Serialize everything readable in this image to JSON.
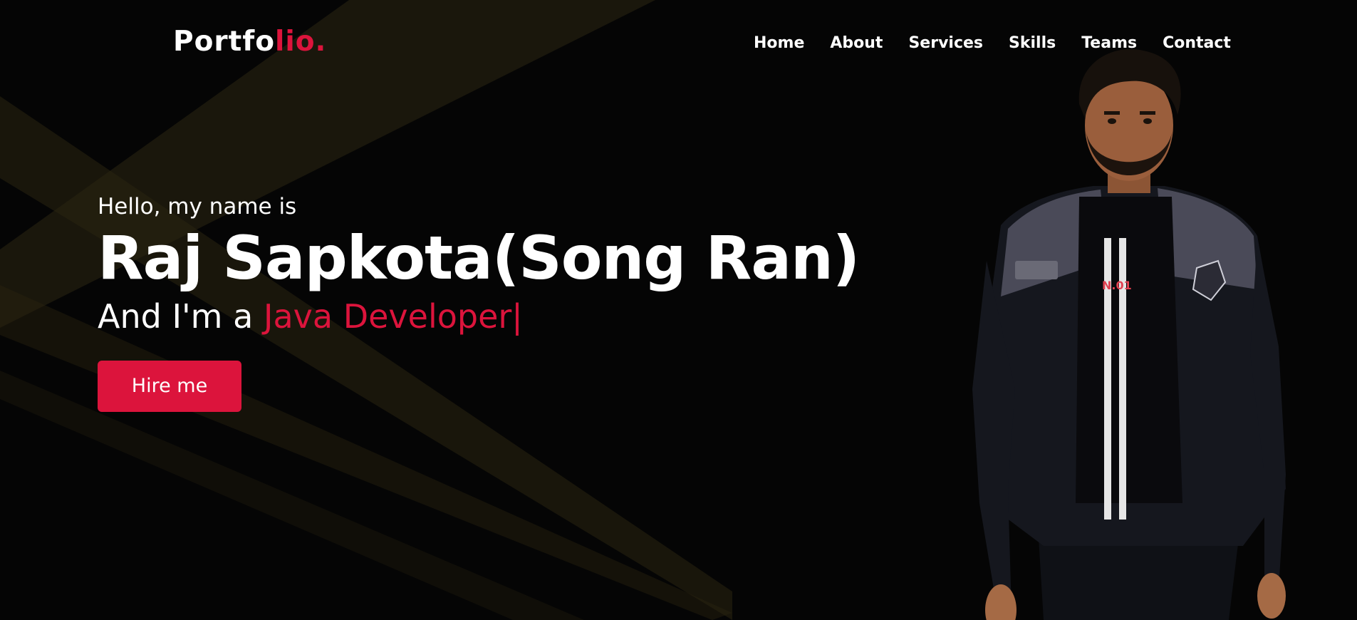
{
  "nav": {
    "logo_main": "Portfo",
    "logo_accent": "lio.",
    "items": [
      "Home",
      "About",
      "Services",
      "Skills",
      "Teams",
      "Contact"
    ]
  },
  "hero": {
    "greeting": "Hello, my name is",
    "name": "Raj Sapkota(Song Ran)",
    "role_prefix": "And I'm a ",
    "role_typed": "Java Developer",
    "cursor": "|",
    "button_label": "Hire me"
  },
  "colors": {
    "accent": "#dc143c",
    "background": "#050505",
    "text": "#ffffff"
  }
}
